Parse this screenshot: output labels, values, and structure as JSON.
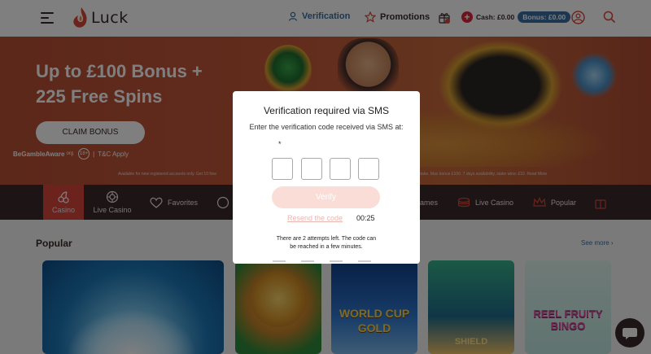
{
  "header": {
    "logo_text": "Luck",
    "nav": {
      "verification": "Verification",
      "promotions": "Promotions"
    },
    "balance": {
      "cash": "Cash: £0.00",
      "bonus": "Bonus: £0.00"
    },
    "icons": [
      "menu-icon",
      "logo-flame-icon",
      "person-icon",
      "star-icon",
      "gift-icon",
      "plus-icon",
      "user-icon",
      "search-icon"
    ]
  },
  "banner": {
    "title_line1": "Up to £100 Bonus +",
    "title_line2": "225 Free Spins",
    "claim_label": "CLAIM BONUS",
    "gamble_aware": "BeGambleAware",
    "gamble_aware_suffix": "org",
    "age": "18+",
    "tc": "T&C Apply",
    "terms_left": "Available for new registered accounts only. Get 10 free",
    "terms_right": "e stake. Max bonus £100. 7 days availability, stake wins: £10.   Read More"
  },
  "categories": [
    {
      "label": "Casino",
      "icon": "cherries-icon"
    },
    {
      "label": "Live Casino",
      "icon": "roulette-icon"
    },
    {
      "label": "Favorites",
      "icon": "heart-icon"
    },
    {
      "label": "ames",
      "icon": ""
    },
    {
      "label": "Live Casino",
      "icon": "chips-icon"
    },
    {
      "label": "Popular",
      "icon": "crown-icon"
    }
  ],
  "content": {
    "section_title": "Popular",
    "see_more": "See more ›",
    "tiles": [
      {
        "title": ""
      },
      {
        "title": ""
      },
      {
        "title": "WORLD CUP GOLD"
      },
      {
        "title": "SHIELD"
      },
      {
        "title": "REEL FRUITY BINGO"
      }
    ]
  },
  "modal": {
    "title": "Verification required via SMS",
    "subtitle": "Enter the verification code received via SMS at:",
    "phone": "*",
    "verify_label": "Verify",
    "resend_label": "Resend the code",
    "timer": "00:25",
    "attempts_line1": "There are 2 attempts left. The code can",
    "attempts_line2": "be reached in a few minutes."
  },
  "colors": {
    "brand_dark": "#3b2a2a",
    "accent_red": "#d9463a",
    "link_blue": "#3b6ea3",
    "verify_disabled": "#fbddd8"
  }
}
